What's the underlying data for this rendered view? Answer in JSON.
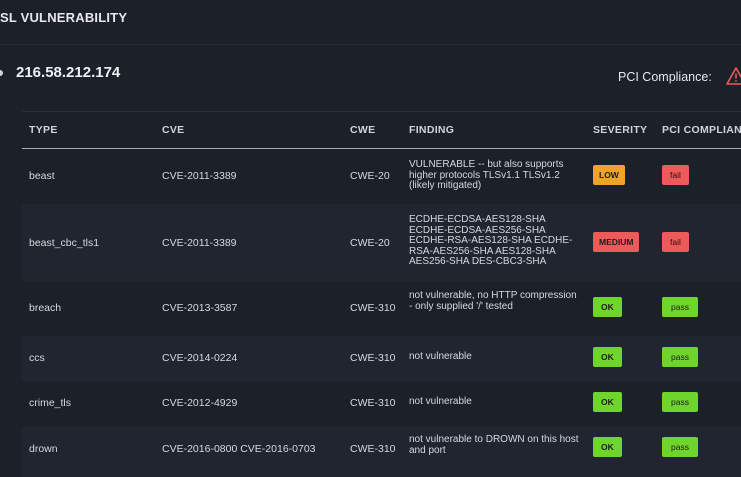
{
  "section": {
    "title": "SL VULNERABILITY"
  },
  "host": {
    "ip": "216.58.212.174",
    "pci_label": "PCI Compliance:"
  },
  "icons": {
    "warning": "warning-triangle-icon",
    "host": "bullet-dot-icon"
  },
  "colors": {
    "low": "#f0a32c",
    "medium": "#ec5a59",
    "ok": "#6fd42b",
    "fail": "#ec5a59",
    "pass": "#6fd42b"
  },
  "table": {
    "headers": [
      "TYPE",
      "CVE",
      "CWE",
      "FINDING",
      "SEVERITY",
      "PCI COMPLIANCE"
    ],
    "rows": [
      {
        "type": "beast",
        "cve": "CVE-2011-3389",
        "cwe": "CWE-20",
        "finding": "VULNERABLE -- but also supports higher protocols TLSv1.1 TLSv1.2 (likely mitigated)",
        "severity": "LOW",
        "pci": "fail"
      },
      {
        "type": "beast_cbc_tls1",
        "cve": "CVE-2011-3389",
        "cwe": "CWE-20",
        "finding": "ECDHE-ECDSA-AES128-SHA ECDHE-ECDSA-AES256-SHA ECDHE-RSA-AES128-SHA ECDHE-RSA-AES256-SHA AES128-SHA AES256-SHA DES-CBC3-SHA",
        "severity": "MEDIUM",
        "pci": "fail"
      },
      {
        "type": "breach",
        "cve": "CVE-2013-3587",
        "cwe": "CWE-310",
        "finding": "not vulnerable, no HTTP compression - only supplied '/' tested",
        "severity": "OK",
        "pci": "pass"
      },
      {
        "type": "ccs",
        "cve": "CVE-2014-0224",
        "cwe": "CWE-310",
        "finding": "not vulnerable",
        "severity": "OK",
        "pci": "pass"
      },
      {
        "type": "crime_tls",
        "cve": "CVE-2012-4929",
        "cwe": "CWE-310",
        "finding": "not vulnerable",
        "severity": "OK",
        "pci": "pass"
      },
      {
        "type": "drown",
        "cve": "CVE-2016-0800 CVE-2016-0703",
        "cwe": "CWE-310",
        "finding": "not vulnerable to DROWN on this host and port",
        "severity": "OK",
        "pci": "pass"
      }
    ]
  }
}
